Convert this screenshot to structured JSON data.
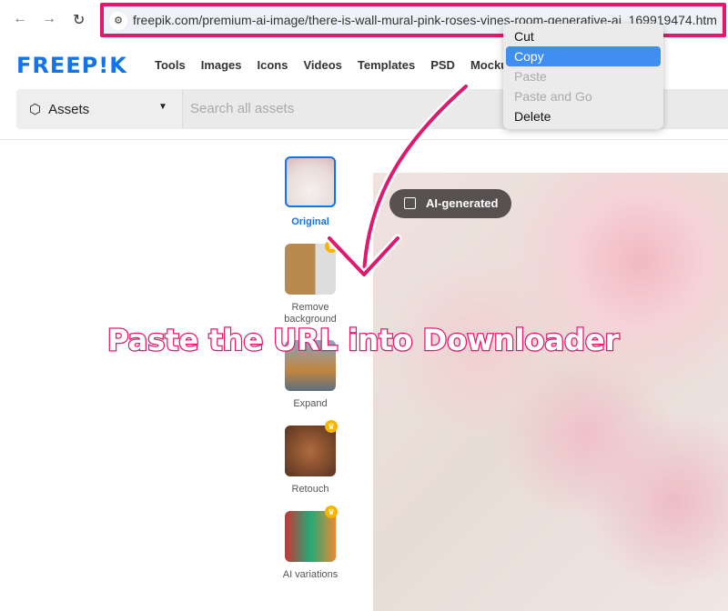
{
  "browser": {
    "url": "freepik.com/premium-ai-image/there-is-wall-mural-pink-roses-vines-room-generative-ai_169919474.htm"
  },
  "context_menu": {
    "items": [
      {
        "label": "Cut",
        "state": "normal"
      },
      {
        "label": "Copy",
        "state": "selected"
      },
      {
        "label": "Paste",
        "state": "disabled"
      },
      {
        "label": "Paste and Go",
        "state": "disabled"
      },
      {
        "label": "Delete",
        "state": "normal"
      }
    ]
  },
  "header": {
    "logo": "FREEP!K",
    "menu": [
      "Tools",
      "Images",
      "Icons",
      "Videos",
      "Templates",
      "PSD",
      "Mockups"
    ]
  },
  "search": {
    "category": "Assets",
    "placeholder": "Search all assets"
  },
  "tools": [
    {
      "label": "Original"
    },
    {
      "label": "Remove background"
    },
    {
      "label": "Expand"
    },
    {
      "label": "Retouch"
    },
    {
      "label": "AI variations"
    }
  ],
  "image": {
    "badge": "AI-generated"
  },
  "annotation": {
    "text": "Paste the URL into Downloader",
    "color": "#e0186e"
  }
}
